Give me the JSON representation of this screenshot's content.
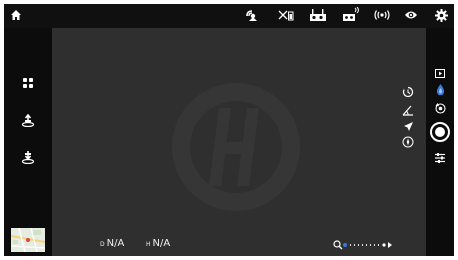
{
  "colors": {
    "camera_bg": "#2f2f2f",
    "bars": "#0c0c0c",
    "accent": "#3a78d8",
    "icon": "#ffffff"
  },
  "top_bar": {
    "icons": [
      "home-icon",
      "satellite-icon",
      "aircraft-battery-icon",
      "remote-controller-icon",
      "remote-controller-signal-icon",
      "wireless-signal-icon",
      "visibility-icon",
      "settings-icon"
    ]
  },
  "left_bar": {
    "icons": [
      "menu-grid-icon",
      "takeoff-icon",
      "land-icon"
    ]
  },
  "camera_view": {
    "overlay_icons": [
      "timer-icon",
      "angle-icon",
      "plane-icon",
      "compass-icon"
    ]
  },
  "readouts": {
    "distance": {
      "prefix": "D",
      "value": "N/A"
    },
    "height": {
      "prefix": "H",
      "value": "N/A"
    }
  },
  "zoom": {
    "icon": "zoom-search-icon",
    "level_fraction": 0.0
  },
  "right_bar": {
    "icons": [
      "playback-icon",
      "mode-drop-icon",
      "camera-switch-icon",
      "shutter-button",
      "camera-settings-icon"
    ]
  }
}
